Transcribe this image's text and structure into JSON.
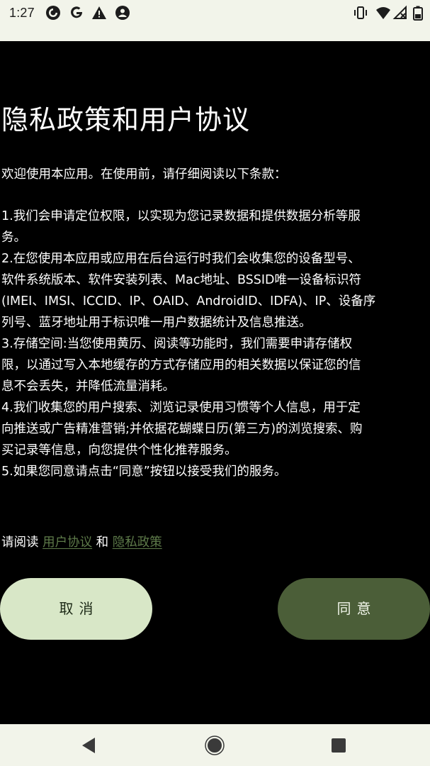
{
  "status_bar": {
    "time": "1:27",
    "left_icons": [
      "pocket-casts-icon",
      "google-icon",
      "warning-icon",
      "account-icon"
    ],
    "right_icons": [
      "vibrate-icon",
      "wifi-icon",
      "signal-off-icon",
      "battery-icon"
    ]
  },
  "dialog": {
    "title": "隐私政策和用户协议",
    "intro": "欢迎使用本应用。在使用前，请仔细阅读以下条款：",
    "terms_lines": [
      "1.我们会申请定位权限，以实现为您记录数据和提供数据分析等服",
      "务。",
      "2.在您使用本应用或应用在后台运行时我们会收集您的设备型号、",
      "软件系统版本、软件安装列表、Mac地址、BSSID唯一设备标识符",
      "(IMEI、IMSI、ICCID、IP、OAID、AndroidID、IDFA)、IP、设备序",
      "列号、蓝牙地址用于标识唯一用户数据统计及信息推送。",
      "3.存储空间:当您使用黄历、阅读等功能时，我们需要申请存储权",
      "限，以通过写入本地缓存的方式存储应用的相关数据以保证您的信",
      "息不会丢失，并降低流量消耗。",
      "4.我们收集您的用户搜索、浏览记录使用习惯等个人信息，用于定",
      "向推送或广告精准营销;并依据花蝴蝶日历(第三方)的浏览搜索、购",
      "买记录等信息，向您提供个性化推荐服务。",
      "5.如果您同意请点击“同意”按钮以接受我们的服务。"
    ],
    "read_prefix": "请阅读",
    "user_agreement_link": "用户协议",
    "and_text": "和",
    "privacy_policy_link": "隐私政策",
    "cancel_label": "取消",
    "agree_label": "同意"
  },
  "colors": {
    "background": "#000000",
    "bars": "#f2f4ea",
    "link": "#5e7b4a",
    "cancel_button": "#d8e7c7",
    "agree_button": "#4b5e38"
  },
  "nav_bar": {
    "buttons": [
      "back-icon",
      "home-icon",
      "recents-icon"
    ]
  }
}
